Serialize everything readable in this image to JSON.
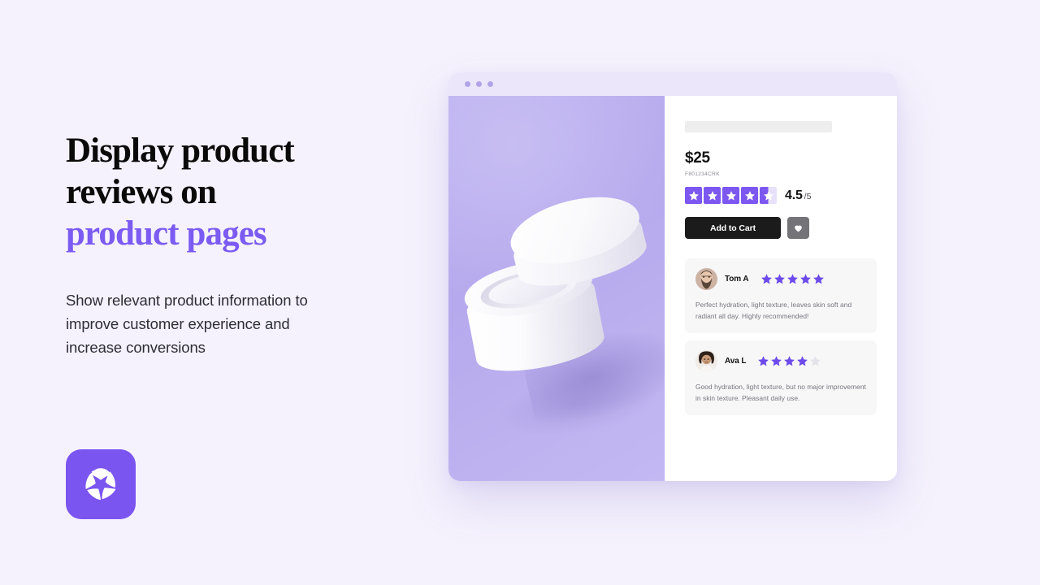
{
  "page": {
    "background_color": "#f5f2fd",
    "accent_color": "#7b5bf2"
  },
  "hero": {
    "headline_line1": "Display product",
    "headline_line2": "reviews on",
    "headline_line3_accent": "product pages",
    "subcopy_line1": "Show relevant product information",
    "subcopy_line2": "to improve customer experience",
    "subcopy_line3": "and increase conversions",
    "logo": {
      "icon": "pinwheel-star-logo-icon",
      "background_color": "#7b55f0"
    }
  },
  "browser": {
    "titlebar": {
      "background_color": "#ece6fb",
      "dots": [
        "window-dot-1",
        "window-dot-2",
        "window-dot-3"
      ]
    },
    "product_media": {
      "icon": "cosmetic-jar-photo",
      "background_color": "#b9acee"
    },
    "product": {
      "title_placeholder": "",
      "price": "$25",
      "sku": "F801234CRK",
      "rating": {
        "stars_filled": 4.5,
        "stars_total": 5,
        "value": "4.5",
        "max": "/5",
        "tile_color": "#7c57f0",
        "tile_empty_color": "#e8e1fc"
      },
      "add_to_cart_label": "Add to Cart",
      "wishlist_icon": "heart-icon"
    },
    "reviews": [
      {
        "author": "Tom A",
        "avatar": "avatar-bearded-man",
        "stars": 5,
        "text": "Perfect hydration, light texture, leaves skin soft and radiant all day. Highly recommended!"
      },
      {
        "author": "Ava L",
        "avatar": "avatar-curly-hair-woman",
        "stars": 4,
        "text": "Good hydration, light texture, but no major improvement in skin texture. Pleasant daily use."
      }
    ]
  }
}
